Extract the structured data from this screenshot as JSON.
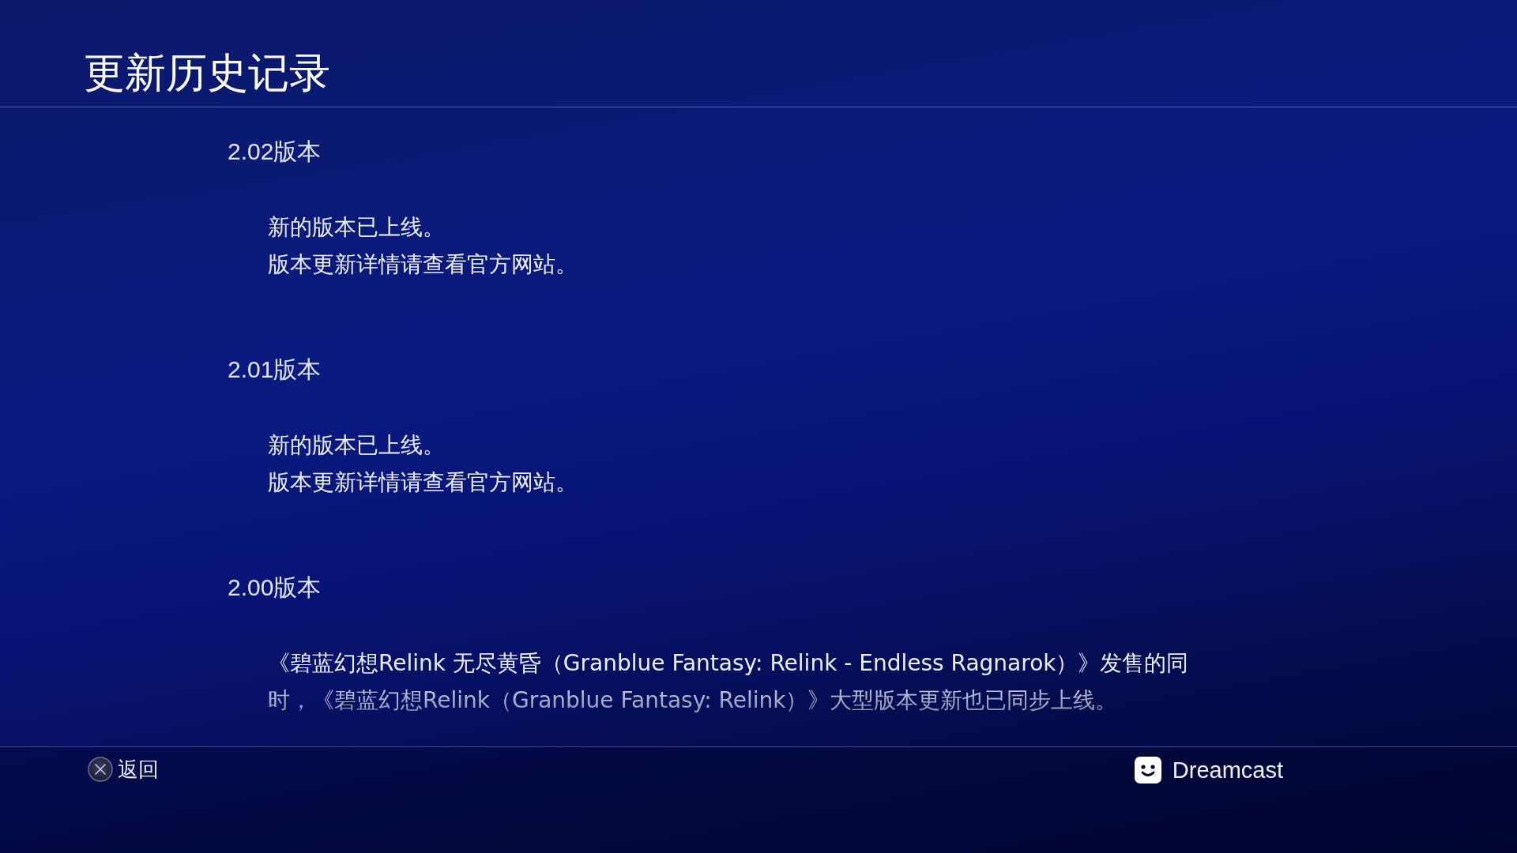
{
  "screen": {
    "title": "更新历史记录"
  },
  "versions": [
    {
      "heading": "2.02版本",
      "notes": [
        "新的版本已上线。",
        "版本更新详情请查看官方网站。"
      ]
    },
    {
      "heading": "2.01版本",
      "notes": [
        "新的版本已上线。",
        "版本更新详情请查看官方网站。"
      ]
    },
    {
      "heading": "2.00版本",
      "notes": [
        "《碧蓝幻想Relink 无尽黄昏（Granblue Fantasy: Relink - Endless Ragnarok）》发售的同时，《碧蓝幻想Relink（Granblue Fantasy: Relink）》大型版本更新也已同步上线。"
      ]
    }
  ],
  "footer": {
    "back_button": {
      "label": "返回"
    },
    "user": {
      "name": "Dreamcast"
    }
  }
}
